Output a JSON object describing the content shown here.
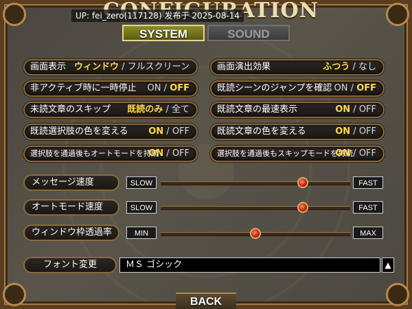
{
  "window": {
    "title": "CONFIGURATION",
    "overlay_text": "UP: fei_zero(117128) 发布于 2025-08-14"
  },
  "tabs": [
    {
      "label": "SYSTEM",
      "active": true
    },
    {
      "label": "SOUND",
      "active": false
    }
  ],
  "options": {
    "display_mode": {
      "label": "画面表示",
      "values": [
        "ウィンドウ",
        "フルスクリーン"
      ],
      "selected": 0
    },
    "screen_effect": {
      "label": "画面演出効果",
      "values": [
        "ふつう",
        "なし"
      ],
      "selected": 0
    },
    "inactive_pause": {
      "label": "非アクティブ時に一時停止",
      "values": [
        "ON",
        "OFF"
      ],
      "selected": 1
    },
    "confirm_jump_read": {
      "label": "既読シーンのジャンプを確認",
      "values": [
        "ON",
        "OFF"
      ],
      "selected": 1
    },
    "skip_unread": {
      "label": "未読文章のスキップ",
      "values": [
        "既読のみ",
        "全て"
      ],
      "selected": 0
    },
    "fast_read_text": {
      "label": "既読文章の最速表示",
      "values": [
        "ON",
        "OFF"
      ],
      "selected": 0
    },
    "read_choice_color": {
      "label": "既読選択肢の色を変える",
      "values": [
        "ON",
        "OFF"
      ],
      "selected": 0
    },
    "read_text_color": {
      "label": "既読文章の色を変える",
      "values": [
        "ON",
        "OFF"
      ],
      "selected": 0
    },
    "auto_after_choice": {
      "label": "選択肢を通過後もオートモードを持続",
      "values": [
        "ON",
        "OFF"
      ],
      "selected": 0
    },
    "skip_after_choice": {
      "label": "選択肢を通過後もスキップモードを持続",
      "values": [
        "ON",
        "OFF"
      ],
      "selected": 0
    }
  },
  "sliders": [
    {
      "label": "メッセージ速度",
      "min_label": "SLOW",
      "max_label": "FAST",
      "value": 0.75
    },
    {
      "label": "オートモード速度",
      "min_label": "SLOW",
      "max_label": "FAST",
      "value": 0.75
    },
    {
      "label": "ウィンドウ枠透過率",
      "min_label": "MIN",
      "max_label": "MAX",
      "value": 0.5
    }
  ],
  "font": {
    "label": "フォント変更",
    "value": "ＭＳ ゴシック",
    "button": "▲"
  },
  "back": {
    "label": "BACK"
  },
  "separator": "/",
  "colors": {
    "selected": "#ffd94a",
    "unselected": "#e0e0e0",
    "frame": "#8b6a3a",
    "tab_active": "#8c8c2a"
  }
}
